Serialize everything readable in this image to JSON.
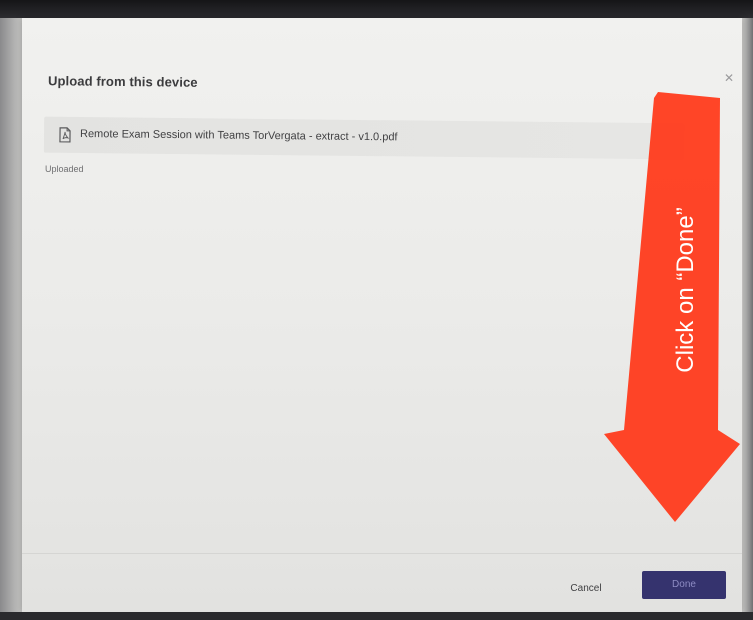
{
  "dialog": {
    "title": "Upload from this device",
    "close_icon": "close-icon",
    "file": {
      "icon": "pdf-file-icon",
      "name": "Remote Exam Session with Teams TorVergata - extract - v1.0.pdf",
      "status": "Uploaded"
    },
    "buttons": {
      "cancel_label": "Cancel",
      "done_label": "Done"
    }
  },
  "annotation": {
    "text": "Click on “Done”",
    "arrow_color": "#ff3b1c",
    "arrow_direction": "down"
  },
  "colors": {
    "done_button": "#35336e",
    "done_text": "#8e8cc4",
    "dialog_background": "#ebebe9"
  }
}
